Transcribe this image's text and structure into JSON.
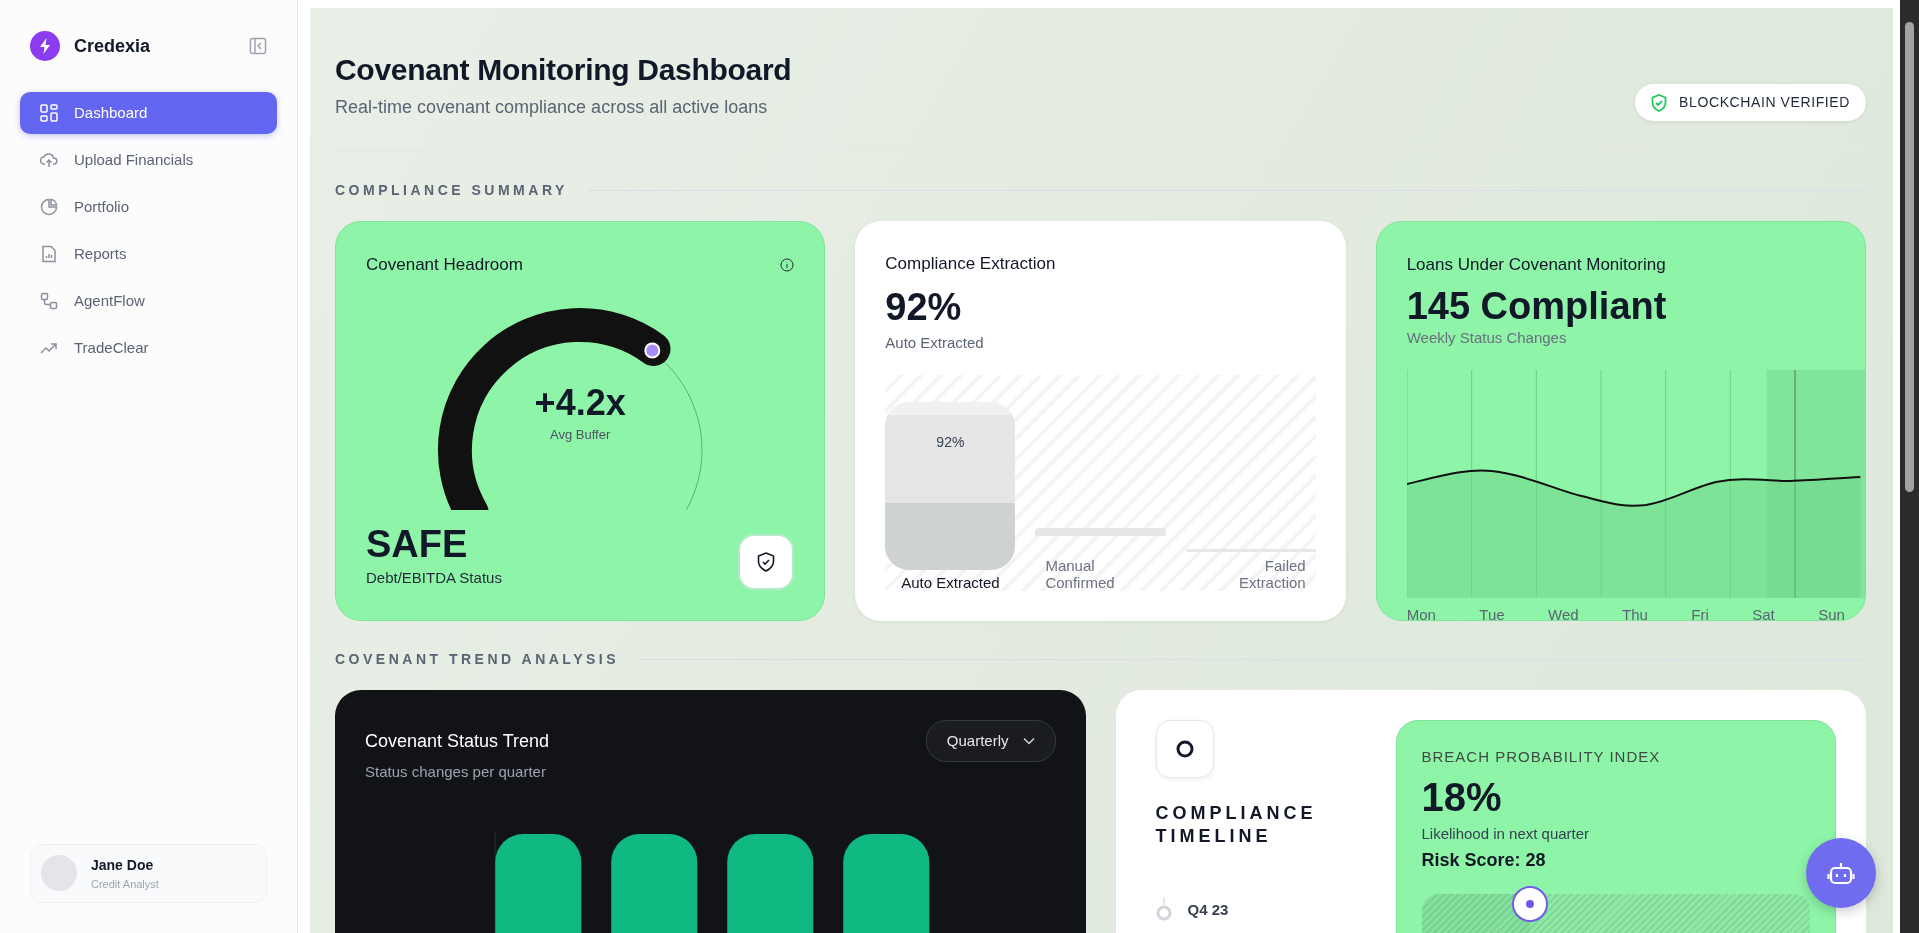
{
  "app": {
    "name": "Credexia"
  },
  "sidebar": {
    "items": [
      {
        "label": "Dashboard",
        "selected": true
      },
      {
        "label": "Upload Financials",
        "selected": false
      },
      {
        "label": "Portfolio",
        "selected": false
      },
      {
        "label": "Reports",
        "selected": false
      },
      {
        "label": "AgentFlow",
        "selected": false
      },
      {
        "label": "TradeClear",
        "selected": false
      }
    ],
    "user": {
      "name": "Jane Doe",
      "role": "Credit Analyst"
    }
  },
  "header": {
    "title": "Covenant Monitoring Dashboard",
    "subtitle": "Real-time covenant compliance across all active loans",
    "badge": "BLOCKCHAIN VERIFIED"
  },
  "summary": {
    "heading": "COMPLIANCE SUMMARY",
    "headroom": {
      "title": "Covenant Headroom",
      "value": "+4.2x",
      "value_label": "Avg Buffer",
      "status": "SAFE",
      "status_label": "Debt/EBITDA Status"
    },
    "extraction": {
      "title": "Compliance Extraction",
      "value": "92%",
      "value_label": "Auto Extracted",
      "bars": [
        {
          "label": "Auto Extracted",
          "value": "92%"
        },
        {
          "label": "Manual Confirmed"
        },
        {
          "label": "Failed Extraction"
        }
      ]
    },
    "monitoring": {
      "title": "Loans Under Covenant Monitoring",
      "value": "145 Compliant",
      "value_label": "Weekly Status Changes",
      "days": [
        {
          "label": "Mon",
          "highlighted": false
        },
        {
          "label": "Tue",
          "highlighted": false
        },
        {
          "label": "Wed",
          "highlighted": false
        },
        {
          "label": "Thu",
          "highlighted": false
        },
        {
          "label": "Fri",
          "highlighted": false
        },
        {
          "label": "Sat",
          "highlighted": false
        },
        {
          "label": "Sun",
          "highlighted": true
        }
      ]
    }
  },
  "trend": {
    "heading": "COVENANT TREND ANALYSIS",
    "status_trend": {
      "title": "Covenant Status Trend",
      "subtitle": "Status changes per quarter",
      "period": "Quarterly"
    },
    "timeline": {
      "title": "COMPLIANCE TIMELINE",
      "items": [
        {
          "label": "Q4 23"
        }
      ]
    },
    "breach": {
      "title": "BREACH PROBABILITY INDEX",
      "value": "18%",
      "value_label": "Likelihood in next quarter",
      "risk": "Risk Score: 28",
      "level": 0.28
    }
  }
}
